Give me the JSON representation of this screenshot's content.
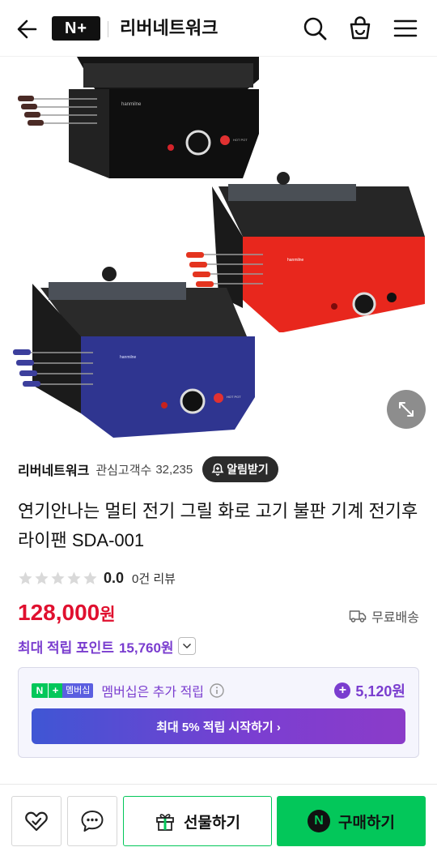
{
  "header": {
    "logo_text": "N+",
    "store_title": "리버네트워크"
  },
  "seller": {
    "name": "리버네트워크",
    "fan_label": "관심고객수",
    "fan_count": "32,235",
    "alarm_label": "알림받기"
  },
  "product": {
    "title": "연기안나는 멀티 전기 그릴 화로 고기 불판 기계 전기후라이팬 SDA-001",
    "rating": "0.0",
    "rating_fraction": 0,
    "review_count": "0건 리뷰",
    "price": "128,000",
    "price_unit": "원",
    "shipping": "무료배송",
    "points_label": "최대 적립 포인트",
    "points_value": "15,760원",
    "image_labels": {
      "black": "hanmilne",
      "red": "hanmilne",
      "blue": "hanmilne",
      "hot_pot": "HOT POT"
    }
  },
  "membership": {
    "badge_n": "N",
    "badge_plus": "+",
    "badge_tag": "멤버십",
    "text": "멤버십은 추가 적립",
    "amount": "5,120원",
    "cta": "최대 5% 적립 시작하기 ›"
  },
  "bottom_bar": {
    "gift_label": "선물하기",
    "buy_label": "구매하기",
    "npay_mark": "N"
  },
  "colors": {
    "brand_green": "#03c75a",
    "price_red": "#e0102f",
    "points_purple": "#7a3dcf"
  }
}
